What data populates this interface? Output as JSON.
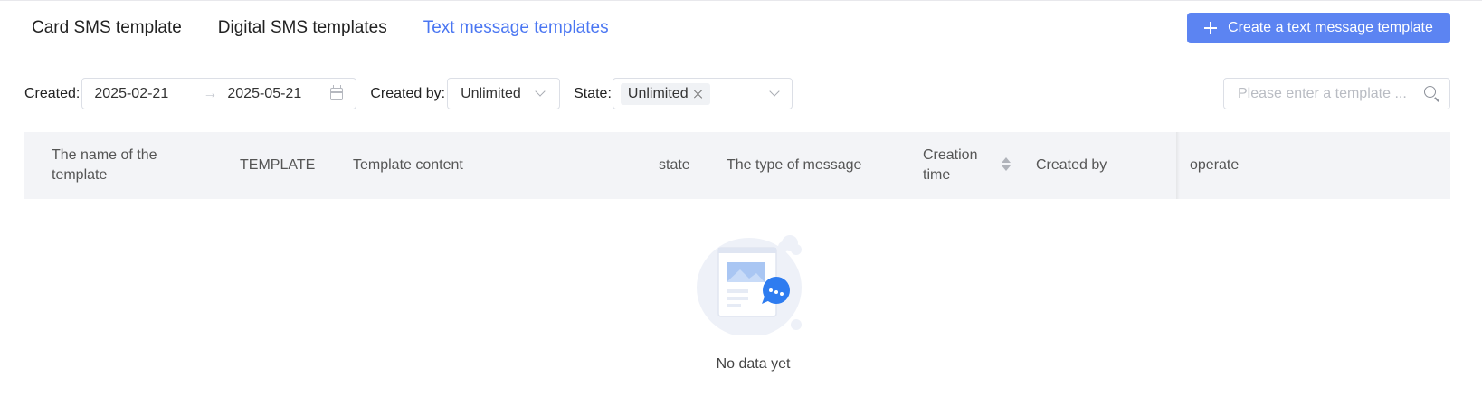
{
  "tabs": [
    {
      "label": "Card SMS template",
      "active": false
    },
    {
      "label": "Digital SMS templates",
      "active": false
    },
    {
      "label": "Text message templates",
      "active": true
    }
  ],
  "create_button": {
    "label": "Create a text message template",
    "icon": "plus-icon"
  },
  "filters": {
    "created_label": "Created:",
    "date_start": "2025-02-21",
    "date_end": "2025-05-21",
    "date_separator": "→",
    "created_by_label": "Created by:",
    "created_by_value": "Unlimited",
    "state_label": "State:",
    "state_tag": "Unlimited"
  },
  "search": {
    "placeholder": "Please enter a template ..."
  },
  "table": {
    "columns": [
      "The name of the template",
      "TEMPLATE",
      "Template content",
      "state",
      "The type of message",
      "Creation time",
      "Created by",
      "operate"
    ]
  },
  "empty": {
    "text": "No data yet"
  },
  "colors": {
    "accent": "#4a76f2",
    "button": "#5c84f2",
    "header_bg": "#f3f4f7"
  }
}
